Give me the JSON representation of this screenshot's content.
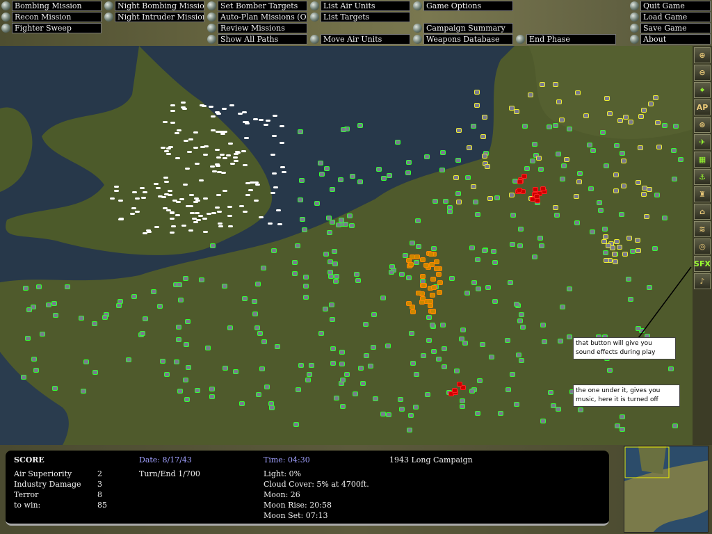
{
  "menu": [
    {
      "label": "Bombing Mission",
      "col": 0,
      "row": 0
    },
    {
      "label": "Recon Mission",
      "col": 0,
      "row": 1
    },
    {
      "label": "Fighter Sweep",
      "col": 0,
      "row": 2
    },
    {
      "label": "Night Bombing Mission",
      "col": 1,
      "row": 0
    },
    {
      "label": "Night Intruder Mission",
      "col": 1,
      "row": 1
    },
    {
      "label": "Set Bomber Targets",
      "col": 2,
      "row": 0
    },
    {
      "label": "Auto-Plan Missions (Off)",
      "col": 2,
      "row": 1
    },
    {
      "label": "Review Missions",
      "col": 2,
      "row": 2
    },
    {
      "label": "Show All Paths",
      "col": 2,
      "row": 3
    },
    {
      "label": "List Air Units",
      "col": 3,
      "row": 0
    },
    {
      "label": "List Targets",
      "col": 3,
      "row": 1
    },
    {
      "label": "Move Air Units",
      "col": 3,
      "row": 3
    },
    {
      "label": "Game Options",
      "col": 4,
      "row": 0
    },
    {
      "label": "Campaign Summary",
      "col": 4,
      "row": 2
    },
    {
      "label": "Weapons Database",
      "col": 4,
      "row": 3
    },
    {
      "label": "End Phase",
      "col": 5,
      "row": 3
    },
    {
      "label": "Quit Game",
      "col": 6,
      "row": 0
    },
    {
      "label": "Load Game",
      "col": 6,
      "row": 1
    },
    {
      "label": "Save Game",
      "col": 6,
      "row": 2
    },
    {
      "label": "About",
      "col": 6,
      "row": 3
    }
  ],
  "toolbar": [
    {
      "name": "zoom-in",
      "glyph": "⊕",
      "green": false
    },
    {
      "name": "zoom-out",
      "glyph": "⊖",
      "green": false
    },
    {
      "name": "crosshair",
      "glyph": "⌖",
      "green": true
    },
    {
      "name": "ap",
      "glyph": "AP",
      "green": false
    },
    {
      "name": "recon-target",
      "glyph": "⊛",
      "green": false
    },
    {
      "name": "airfield",
      "glyph": "✈",
      "green": true
    },
    {
      "name": "factory",
      "glyph": "▦",
      "green": true
    },
    {
      "name": "anchor",
      "glyph": "⚓",
      "green": true
    },
    {
      "name": "tower",
      "glyph": "♜",
      "green": false
    },
    {
      "name": "building",
      "glyph": "⌂",
      "green": false
    },
    {
      "name": "ships",
      "glyph": "≋",
      "green": false
    },
    {
      "name": "target",
      "glyph": "◎",
      "green": false
    },
    {
      "name": "sfx",
      "glyph": "SFX",
      "green": true
    },
    {
      "name": "music",
      "glyph": "♪",
      "green": false
    }
  ],
  "notes": {
    "sfx": "that button will give you sound effects during play",
    "music": "the one under it, gives you music, here it is turned off"
  },
  "status": {
    "score_title": "SCORE",
    "score": [
      {
        "label": "Air Superiority",
        "value": "2"
      },
      {
        "label": "Industry Damage",
        "value": "3"
      },
      {
        "label": "Terror",
        "value": "8"
      },
      {
        "label": "to win:",
        "value": "85"
      }
    ],
    "date": "Date: 8/17/43",
    "turn": "Turn/End 1/700",
    "time": "Time: 04:30",
    "light": "Light: 0%",
    "cloud": "Cloud Cover: 5% at 4700ft.",
    "moon": "Moon: 26",
    "moon_rise": "Moon Rise: 20:58",
    "moon_set": "Moon Set: 07:13",
    "campaign": "1943 Long Campaign"
  }
}
